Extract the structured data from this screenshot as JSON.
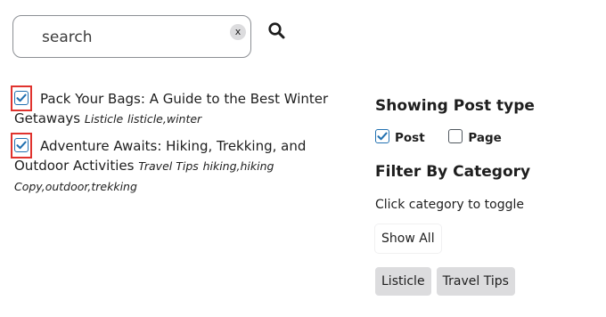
{
  "search": {
    "placeholder": "search",
    "value": "",
    "clear_label": "x"
  },
  "results": [
    {
      "title": "Pack Your Bags: A Guide to the Best Winter Getaways",
      "category": "Listicle",
      "tags": "listicle,winter",
      "checked": true
    },
    {
      "title": "Adventure Awaits: Hiking, Trekking, and Outdoor Activities",
      "category": "Travel Tips",
      "tags": "hiking,hiking Copy,outdoor,trekking",
      "checked": true
    }
  ],
  "sidebar": {
    "post_type_heading": "Showing Post type",
    "post_types": [
      {
        "label": "Post",
        "checked": true
      },
      {
        "label": "Page",
        "checked": false
      }
    ],
    "category_heading": "Filter By Category",
    "hint": "Click category to toggle",
    "show_all_label": "Show All",
    "categories": [
      "Listicle",
      "Travel Tips"
    ]
  },
  "colors": {
    "checkbox_accent": "#2271b1",
    "highlight": "#e0332e",
    "category_button_bg": "#dcdcde"
  }
}
